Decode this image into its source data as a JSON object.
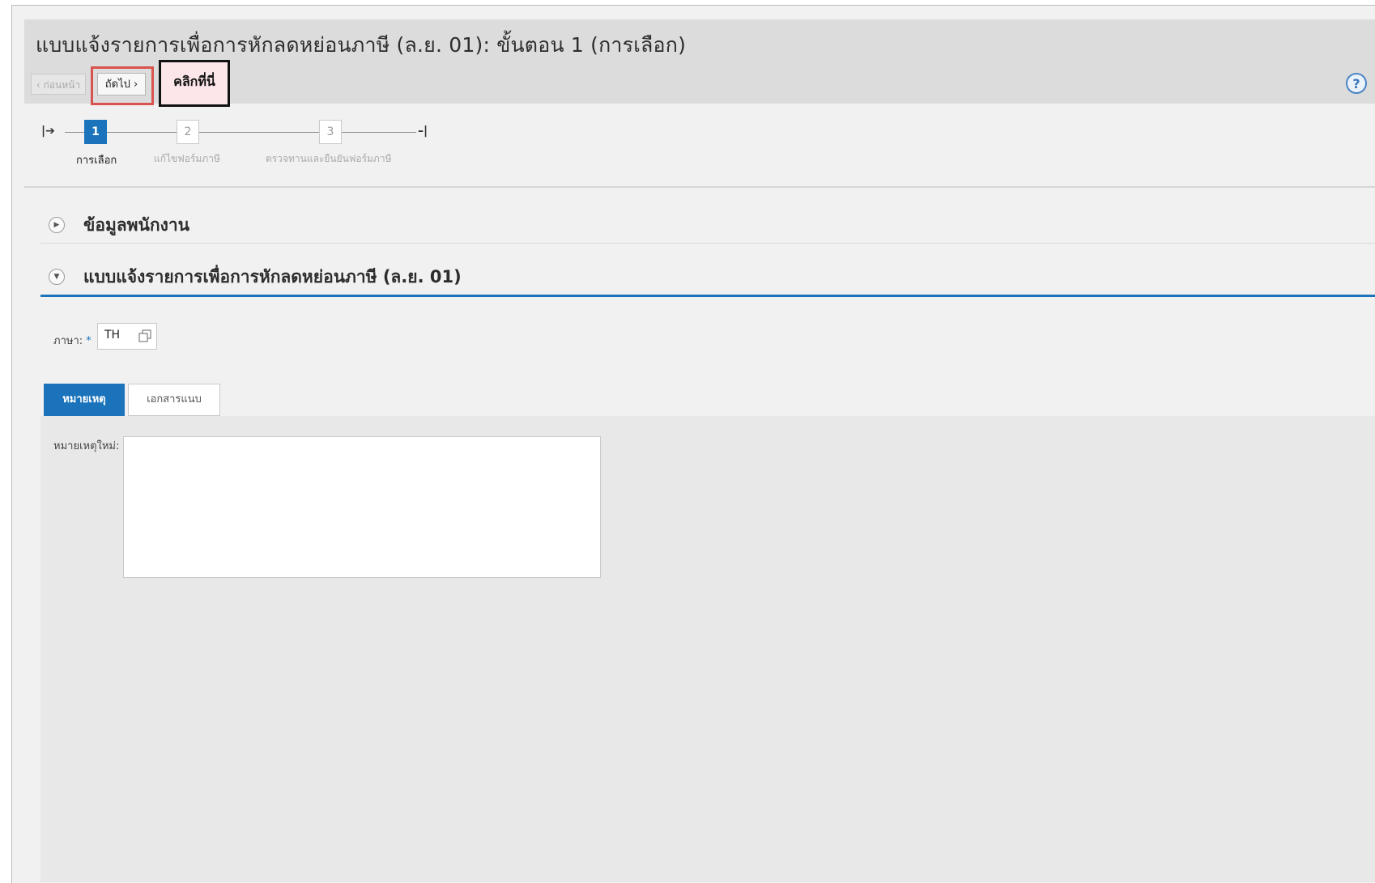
{
  "page": {
    "title": "แบบแจ้งรายการเพื่อการหักลดหย่อนภาษี  (ล.ย. 01): ขั้นตอน  1 (การเลือก)"
  },
  "toolbar": {
    "prev_label": "‹ ก่อนหน้า",
    "next_label": "ถัดไป ›",
    "callout": "คลิกที่นี่",
    "help_icon": "?"
  },
  "stepper": {
    "steps": [
      {
        "number": "1",
        "label": "การเลือก",
        "active": true
      },
      {
        "number": "2",
        "label": "แก้ไขฟอร์มภาษี",
        "active": false
      },
      {
        "number": "3",
        "label": "ตรวจทานและยืนยันฟอร์มภาษี",
        "active": false
      }
    ]
  },
  "sections": {
    "employee_info": "ข้อมูลพนักงาน",
    "tax_form": "แบบแจ้งรายการเพื่อการหักลดหย่อนภาษี  (ล.ย. 01)"
  },
  "language_field": {
    "label": "ภาษา:",
    "required_mark": "*",
    "value": "TH"
  },
  "tabs": [
    {
      "label": "หมายเหตุ",
      "active": true
    },
    {
      "label": "เอกสารแนบ",
      "active": false
    }
  ],
  "notes": {
    "label": "หมายเหตุใหม่:",
    "value": ""
  },
  "colors": {
    "accent": "#1b74bb",
    "highlight_border": "#d9534f",
    "callout_bg": "#fde6ea"
  }
}
